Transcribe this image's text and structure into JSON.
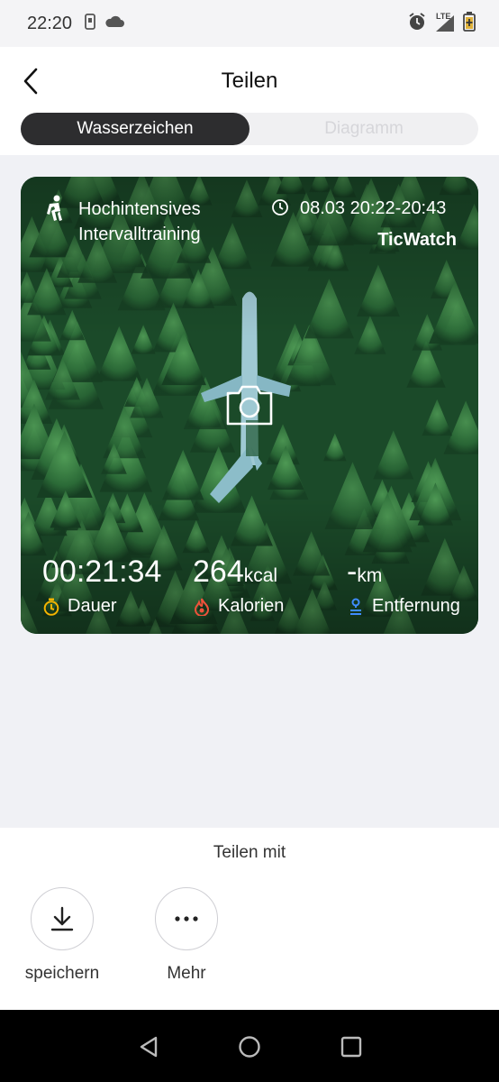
{
  "status_bar": {
    "time": "22:20",
    "icons": [
      "phone-notification-icon",
      "cloud-icon",
      "alarm-icon",
      "lte-signal-icon",
      "battery-charging-icon"
    ],
    "network_label": "LTE"
  },
  "header": {
    "title": "Teilen",
    "tabs": [
      {
        "label": "Wasserzeichen",
        "active": true
      },
      {
        "label": "Diagramm",
        "active": false
      }
    ]
  },
  "card": {
    "workout_lines": [
      "Hochintensives",
      "Intervalltraining"
    ],
    "datetime": "08.03 20:22-20:43",
    "brand": "TicWatch",
    "stats": [
      {
        "value": "00:21:34",
        "unit": "",
        "label": "Dauer",
        "icon": "stopwatch-icon",
        "color": "#f5b400"
      },
      {
        "value": "264",
        "unit": "kcal",
        "label": "Kalorien",
        "icon": "flame-icon",
        "color": "#f0523b"
      },
      {
        "value": "-",
        "unit": "km",
        "label": "Entfernung",
        "icon": "route-icon",
        "color": "#3f8cff"
      }
    ]
  },
  "share": {
    "title": "Teilen mit",
    "actions": [
      {
        "label": "speichern",
        "icon": "download-icon"
      },
      {
        "label": "Mehr",
        "icon": "more-icon"
      }
    ]
  },
  "colors": {
    "segment_active": "#2d2d2f",
    "background": "#f0f1f5",
    "forest": "#1d4d2c"
  }
}
